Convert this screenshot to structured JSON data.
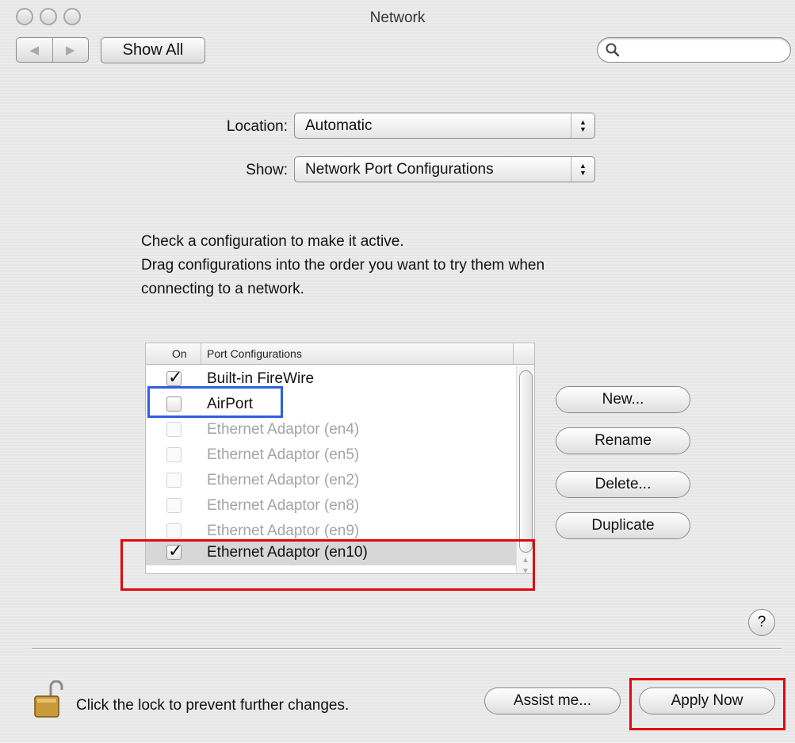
{
  "window": {
    "title": "Network"
  },
  "toolbar": {
    "back_glyph": "◀",
    "forward_glyph": "▶",
    "show_all_label": "Show All",
    "search_placeholder": "",
    "search_value": ""
  },
  "location": {
    "label": "Location:",
    "value": "Automatic"
  },
  "show": {
    "label": "Show:",
    "value": "Network Port Configurations"
  },
  "instructions": {
    "line1": "Check a configuration to make it active.",
    "line2": "Drag configurations into the order you want to try them when",
    "line3": "connecting to a network."
  },
  "table": {
    "columns": [
      "On",
      "Port Configurations"
    ],
    "rows": [
      {
        "label": "Built-in FireWire",
        "checked": true,
        "enabled": true,
        "selected": false
      },
      {
        "label": "AirPort",
        "checked": false,
        "enabled": true,
        "selected": false
      },
      {
        "label": "Ethernet Adaptor (en4)",
        "checked": false,
        "enabled": false,
        "selected": false
      },
      {
        "label": "Ethernet Adaptor (en5)",
        "checked": false,
        "enabled": false,
        "selected": false
      },
      {
        "label": "Ethernet Adaptor (en2)",
        "checked": false,
        "enabled": false,
        "selected": false
      },
      {
        "label": "Ethernet Adaptor (en8)",
        "checked": false,
        "enabled": false,
        "selected": false
      },
      {
        "label": "Ethernet Adaptor (en9)",
        "checked": false,
        "enabled": false,
        "selected": false
      },
      {
        "label": "Ethernet Adaptor (en10)",
        "checked": true,
        "enabled": true,
        "selected": true
      }
    ]
  },
  "buttons": {
    "new": "New...",
    "rename": "Rename",
    "delete": "Delete...",
    "duplicate": "Duplicate",
    "help": "?",
    "assist": "Assist me...",
    "apply": "Apply Now"
  },
  "footer": {
    "lock_text": "Click the lock to prevent further changes."
  },
  "colors": {
    "highlight_red": "#e0080f",
    "highlight_blue": "#2f5fe0"
  }
}
